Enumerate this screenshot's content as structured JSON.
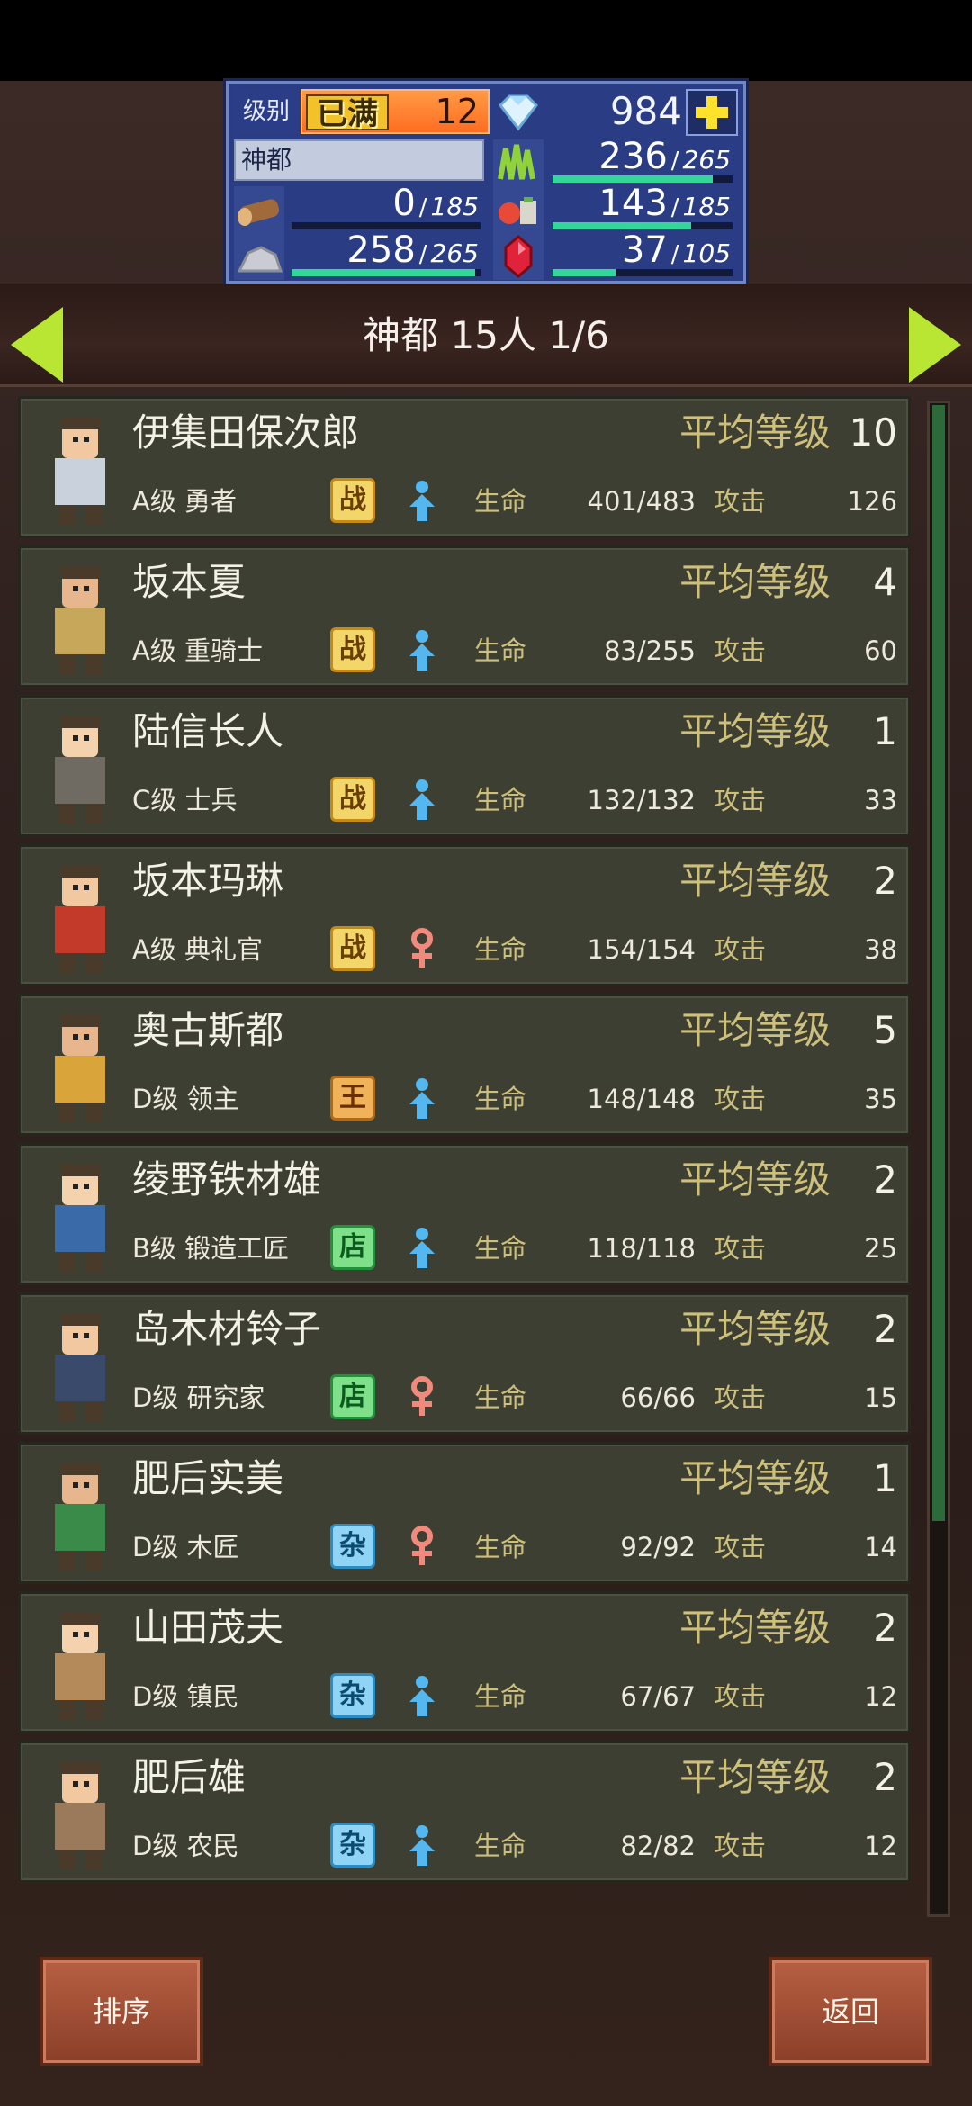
{
  "resources": {
    "level_label": "级别",
    "max_tag": "已满",
    "level": "12",
    "gems": "984",
    "city_name": "神都",
    "wood": {
      "value": "0",
      "max": "185",
      "fill": 0.0
    },
    "grass": {
      "value": "236",
      "max": "265",
      "fill": 0.89
    },
    "food": {
      "value": "143",
      "max": "185",
      "fill": 0.77
    },
    "stone": {
      "value": "258",
      "max": "265",
      "fill": 0.97
    },
    "ruby": {
      "value": "37",
      "max": "105",
      "fill": 0.35
    },
    "slash": "/"
  },
  "header": {
    "title": "神都  15人 1/6"
  },
  "labels": {
    "avg_level": "平均等级",
    "hp": "生命",
    "atk": "攻击"
  },
  "characters": [
    {
      "name": "伊集田保次郎",
      "level": "10",
      "rank": "A级 勇者",
      "type": "战",
      "sex": "male",
      "hp": "401/483",
      "atk": "126"
    },
    {
      "name": "坂本夏",
      "level": "4",
      "rank": "A级 重骑士",
      "type": "战",
      "sex": "male",
      "hp": "83/255",
      "atk": "60"
    },
    {
      "name": "陆信长人",
      "level": "1",
      "rank": "C级 士兵",
      "type": "战",
      "sex": "male",
      "hp": "132/132",
      "atk": "33"
    },
    {
      "name": "坂本玛琳",
      "level": "2",
      "rank": "A级 典礼官",
      "type": "战",
      "sex": "female",
      "hp": "154/154",
      "atk": "38"
    },
    {
      "name": "奥古斯都",
      "level": "5",
      "rank": "D级 领主",
      "type": "王",
      "sex": "male",
      "hp": "148/148",
      "atk": "35"
    },
    {
      "name": "绫野铁材雄",
      "level": "2",
      "rank": "B级 锻造工匠",
      "type": "店",
      "sex": "male",
      "hp": "118/118",
      "atk": "25"
    },
    {
      "name": "岛木材铃子",
      "level": "2",
      "rank": "D级 研究家",
      "type": "店",
      "sex": "female",
      "hp": "66/66",
      "atk": "15"
    },
    {
      "name": "肥后实美",
      "level": "1",
      "rank": "D级 木匠",
      "type": "杂",
      "sex": "female",
      "hp": "92/92",
      "atk": "14"
    },
    {
      "name": "山田茂夫",
      "level": "2",
      "rank": "D级 镇民",
      "type": "杂",
      "sex": "male",
      "hp": "67/67",
      "atk": "12"
    },
    {
      "name": "肥后雄",
      "level": "2",
      "rank": "D级 农民",
      "type": "杂",
      "sex": "male",
      "hp": "82/82",
      "atk": "12"
    }
  ],
  "colors": {
    "type_war_bg": "#f3d66a",
    "type_war_border": "#c68a12",
    "type_war_text": "#6a3e00",
    "type_king_bg": "#f1b35a",
    "type_king_border": "#b06a16",
    "type_king_text": "#6a3000",
    "type_shop_bg": "#7fe08a",
    "type_shop_border": "#23913a",
    "type_shop_text": "#0d5a1f",
    "type_misc_bg": "#8fd4f5",
    "type_misc_border": "#2a8cc4",
    "type_misc_text": "#0d4a70",
    "male": "#55b7ef",
    "female": "#f08a7c"
  },
  "buttons": {
    "sort": "排序",
    "back": "返回"
  }
}
